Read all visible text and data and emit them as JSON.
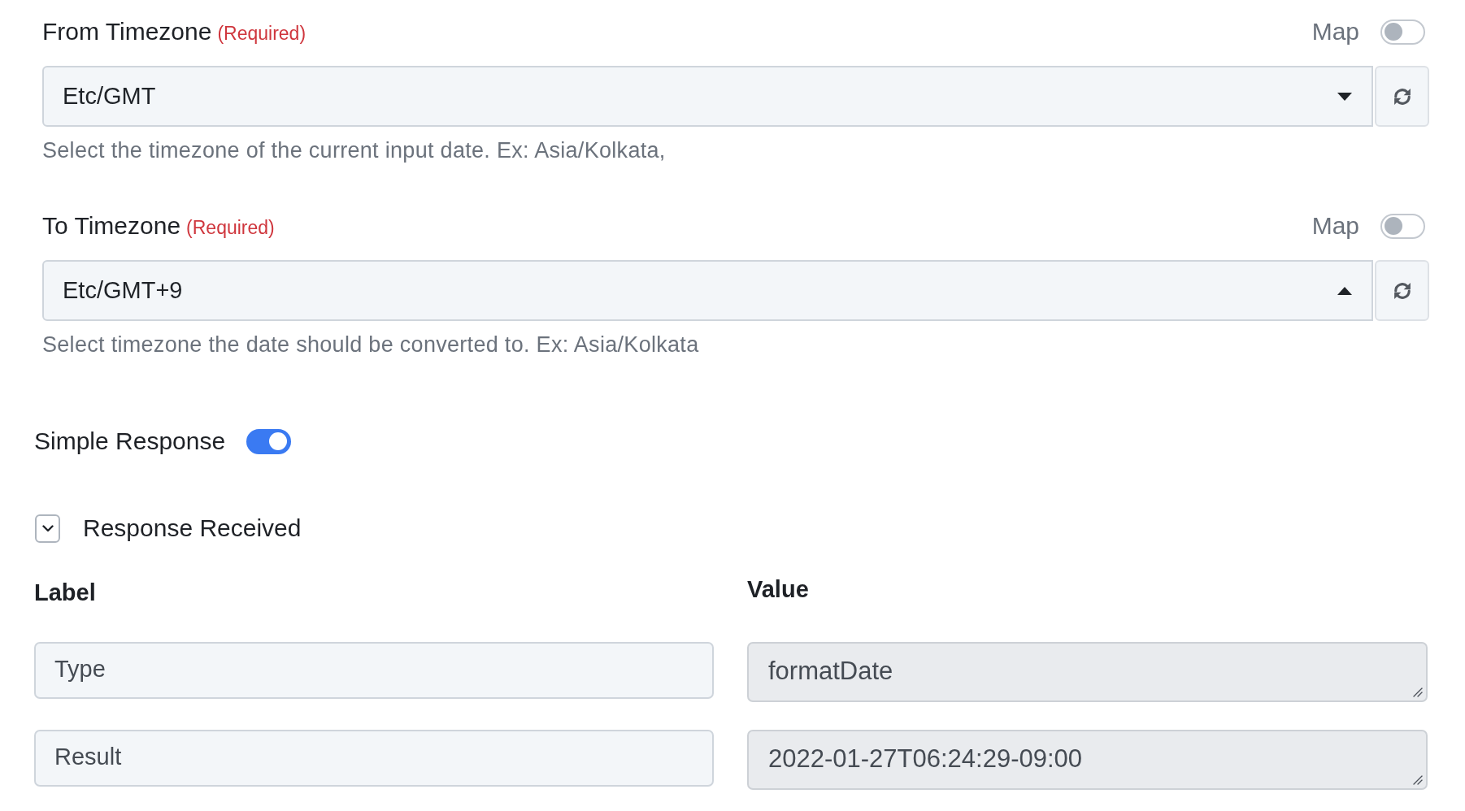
{
  "fields": [
    {
      "label": "From Timezone",
      "required_note": "(Required)",
      "map_label": "Map",
      "map_on": false,
      "value": "Etc/GMT",
      "dropdown_open": false,
      "hint": "Select the timezone of the current input date. Ex: Asia/Kolkata,"
    },
    {
      "label": "To Timezone",
      "required_note": "(Required)",
      "map_label": "Map",
      "map_on": false,
      "value": "Etc/GMT+9",
      "dropdown_open": true,
      "hint": "Select timezone the date should be converted to. Ex: Asia/Kolkata"
    }
  ],
  "simple_response": {
    "label": "Simple Response",
    "on": true
  },
  "response_section": {
    "title": "Response Received",
    "expanded": true,
    "columns": [
      "Label",
      "Value"
    ],
    "rows": [
      {
        "label": "Type",
        "value": "formatDate"
      },
      {
        "label": "Result",
        "value": "2022-01-27T06:24:29-09:00"
      }
    ]
  }
}
